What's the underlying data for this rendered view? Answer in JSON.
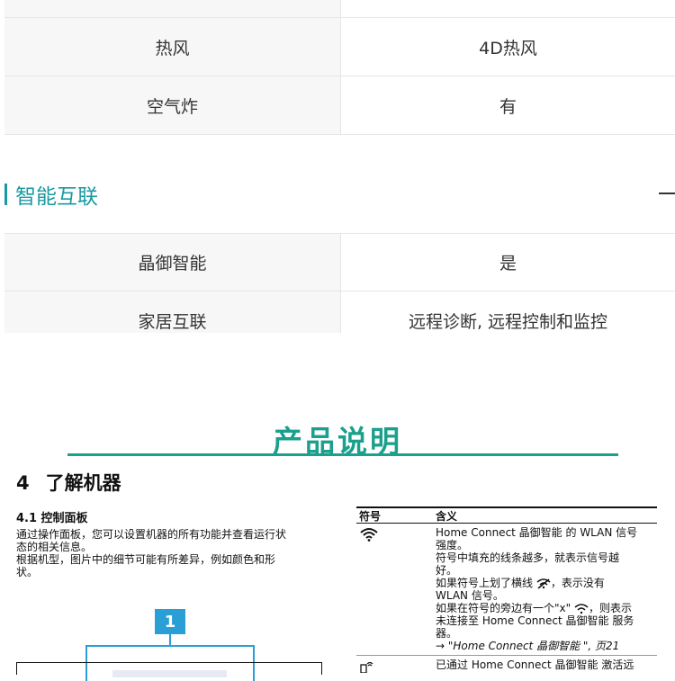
{
  "specs_top": [
    {
      "label": "热风",
      "value": "4D热风"
    },
    {
      "label": "空气炸",
      "value": "有"
    }
  ],
  "section": {
    "title": "智能互联",
    "collapse_icon": "minus-icon"
  },
  "specs_smart": [
    {
      "label": "晶御智能",
      "value": "是"
    },
    {
      "label": "家居互联",
      "value": "远程诊断, 远程控制和监控"
    }
  ],
  "manual": {
    "banner_title": "产品说明",
    "chapter_number": "4",
    "chapter_title": "了解机器",
    "subsection": "4.1  控制面板",
    "desc_lines": [
      "通过操作面板，您可以设置机器的所有功能并查看运行状",
      "态的相关信息。",
      "根据机型，图片中的细节可能有所差异，例如颜色和形",
      "状。"
    ],
    "callout_number": "1",
    "symbol_table": {
      "col_symbol": "符号",
      "col_meaning": "含义",
      "rows": [
        {
          "icon": "wifi-icon",
          "lines": [
            "Home Connect 晶御智能 的 WLAN 信号",
            "强度。",
            "符号中填充的线条越多，就表示信号越",
            "好。",
            "如果符号上划了横线",
            "，表示没有",
            "WLAN 信号。",
            "如果在符号的旁边有一个\"x\"",
            "，则表示",
            "未连接至 Home Connect 晶御智能 服务",
            "器。",
            "→ \"Home Connect 晶御智能 \", 页21"
          ]
        },
        {
          "icon": "remote-icon",
          "lines": [
            "已通过 Home Connect 晶御智能 激活远"
          ]
        }
      ]
    }
  }
}
